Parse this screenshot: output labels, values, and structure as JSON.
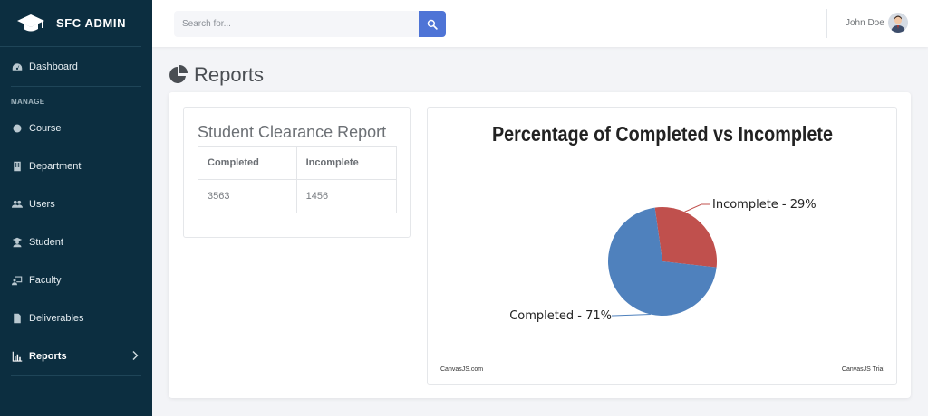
{
  "brand": {
    "name": "SFC ADMIN"
  },
  "sidebar": {
    "items": [
      {
        "label": "Dashboard",
        "icon": "dashboard-icon"
      },
      {
        "label": "Course",
        "icon": "circle-icon"
      },
      {
        "label": "Department",
        "icon": "building-icon"
      },
      {
        "label": "Users",
        "icon": "users-icon"
      },
      {
        "label": "Student",
        "icon": "student-icon"
      },
      {
        "label": "Faculty",
        "icon": "faculty-icon"
      },
      {
        "label": "Deliverables",
        "icon": "document-icon"
      },
      {
        "label": "Reports",
        "icon": "chart-bar-icon",
        "active": true
      }
    ],
    "section_label": "MANAGE"
  },
  "search": {
    "placeholder": "Search for..."
  },
  "user": {
    "name": "John Doe"
  },
  "page": {
    "title": "Reports"
  },
  "report": {
    "title": "Student Clearance Report",
    "columns": [
      "Completed",
      "Incomplete"
    ],
    "values": [
      "3563",
      "1456"
    ]
  },
  "chart_data": {
    "type": "pie",
    "title": "Percentage of Completed vs Incomplete",
    "slices": [
      {
        "label": "Completed",
        "value": 71,
        "display": "Completed - 71%",
        "color": "#4f81bd"
      },
      {
        "label": "Incomplete",
        "value": 29,
        "display": "Incomplete - 29%",
        "color": "#c0504d"
      }
    ],
    "credit_left": "CanvasJS.com",
    "credit_right": "CanvasJS Trial"
  },
  "colors": {
    "sidebar": "#0c2e40",
    "accent": "#4e74d6"
  }
}
